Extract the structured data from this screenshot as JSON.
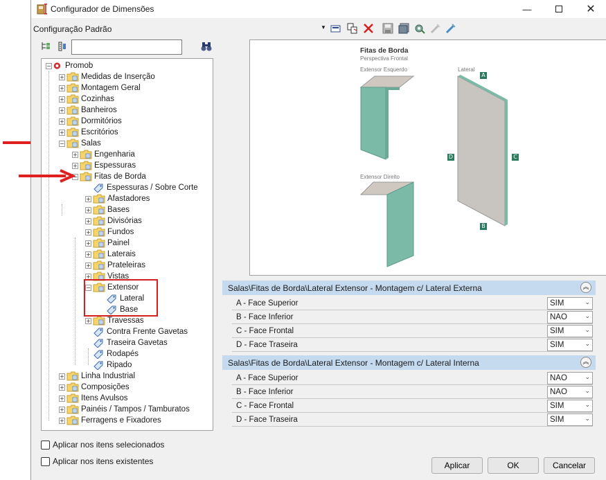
{
  "window": {
    "title": "Configurador de Dimensões",
    "minimize_icon": "minimize-icon",
    "maximize_icon": "maximize-icon",
    "close_icon": "close-icon"
  },
  "config_bar": {
    "label": "Configuração Padrão"
  },
  "tree": {
    "search_value": "",
    "root": "Promob",
    "nodes": {
      "medidas": "Medidas de Inserção",
      "montagem": "Montagem Geral",
      "cozinhas": "Cozinhas",
      "banheiros": "Banheiros",
      "dormitorios": "Dormitórios",
      "escritorios": "Escritórios",
      "salas": "Salas",
      "engenharia": "Engenharia",
      "espessuras": "Espessuras",
      "fitas": "Fitas de Borda",
      "espessuras_sobre_corte": "Espessuras / Sobre Corte",
      "afastadores": "Afastadores",
      "bases": "Bases",
      "divisorias": "Divisórias",
      "fundos": "Fundos",
      "painel": "Painel",
      "laterais": "Laterais",
      "prateleiras": "Prateleiras",
      "vistas": "Vistas",
      "extensor": "Extensor",
      "lateral": "Lateral",
      "base": "Base",
      "travessas": "Travessas",
      "contra_frente": "Contra Frente Gavetas",
      "traseira": "Traseira Gavetas",
      "rodapes": "Rodapés",
      "ripado": "Ripado",
      "linha_industrial": "Linha Industrial",
      "composicoes": "Composições",
      "itens_avulsos": "Itens Avulsos",
      "paineis": "Painéis / Tampos / Tamburatos",
      "ferragens": "Ferragens e Fixadores"
    }
  },
  "preview": {
    "title": "Fitas de Borda",
    "subtitle": "Perspectiva Frontal",
    "label_left": "Extensor Esquerdo",
    "label_right": "Extensor Direito",
    "label_lateral": "Lateral",
    "badges": {
      "a": "A",
      "b": "B",
      "c": "C",
      "d": "D"
    }
  },
  "sections": [
    {
      "title": "Salas\\Fitas de Borda\\Lateral Extensor - Montagem c/ Lateral Externa",
      "rows": [
        {
          "label": "A - Face Superior",
          "value": "SIM"
        },
        {
          "label": "B - Face Inferior",
          "value": "NAO"
        },
        {
          "label": "C - Face Frontal",
          "value": "SIM"
        },
        {
          "label": "D - Face Traseira",
          "value": "SIM"
        }
      ]
    },
    {
      "title": "Salas\\Fitas de Borda\\Lateral Extensor - Montagem c/ Lateral Interna",
      "rows": [
        {
          "label": "A - Face Superior",
          "value": "NAO"
        },
        {
          "label": "B - Face Inferior",
          "value": "NAO"
        },
        {
          "label": "C - Face Frontal",
          "value": "SIM"
        },
        {
          "label": "D - Face Traseira",
          "value": "SIM"
        }
      ]
    }
  ],
  "options": {
    "apply_selected": "Aplicar nos itens selecionados",
    "apply_existing": "Aplicar nos itens existentes"
  },
  "buttons": {
    "apply": "Aplicar",
    "ok": "OK",
    "cancel": "Cancelar"
  },
  "colors": {
    "header_blue": "#c5d9ef",
    "accent_green": "#2a7a5e",
    "annotation_red": "#d02020"
  }
}
